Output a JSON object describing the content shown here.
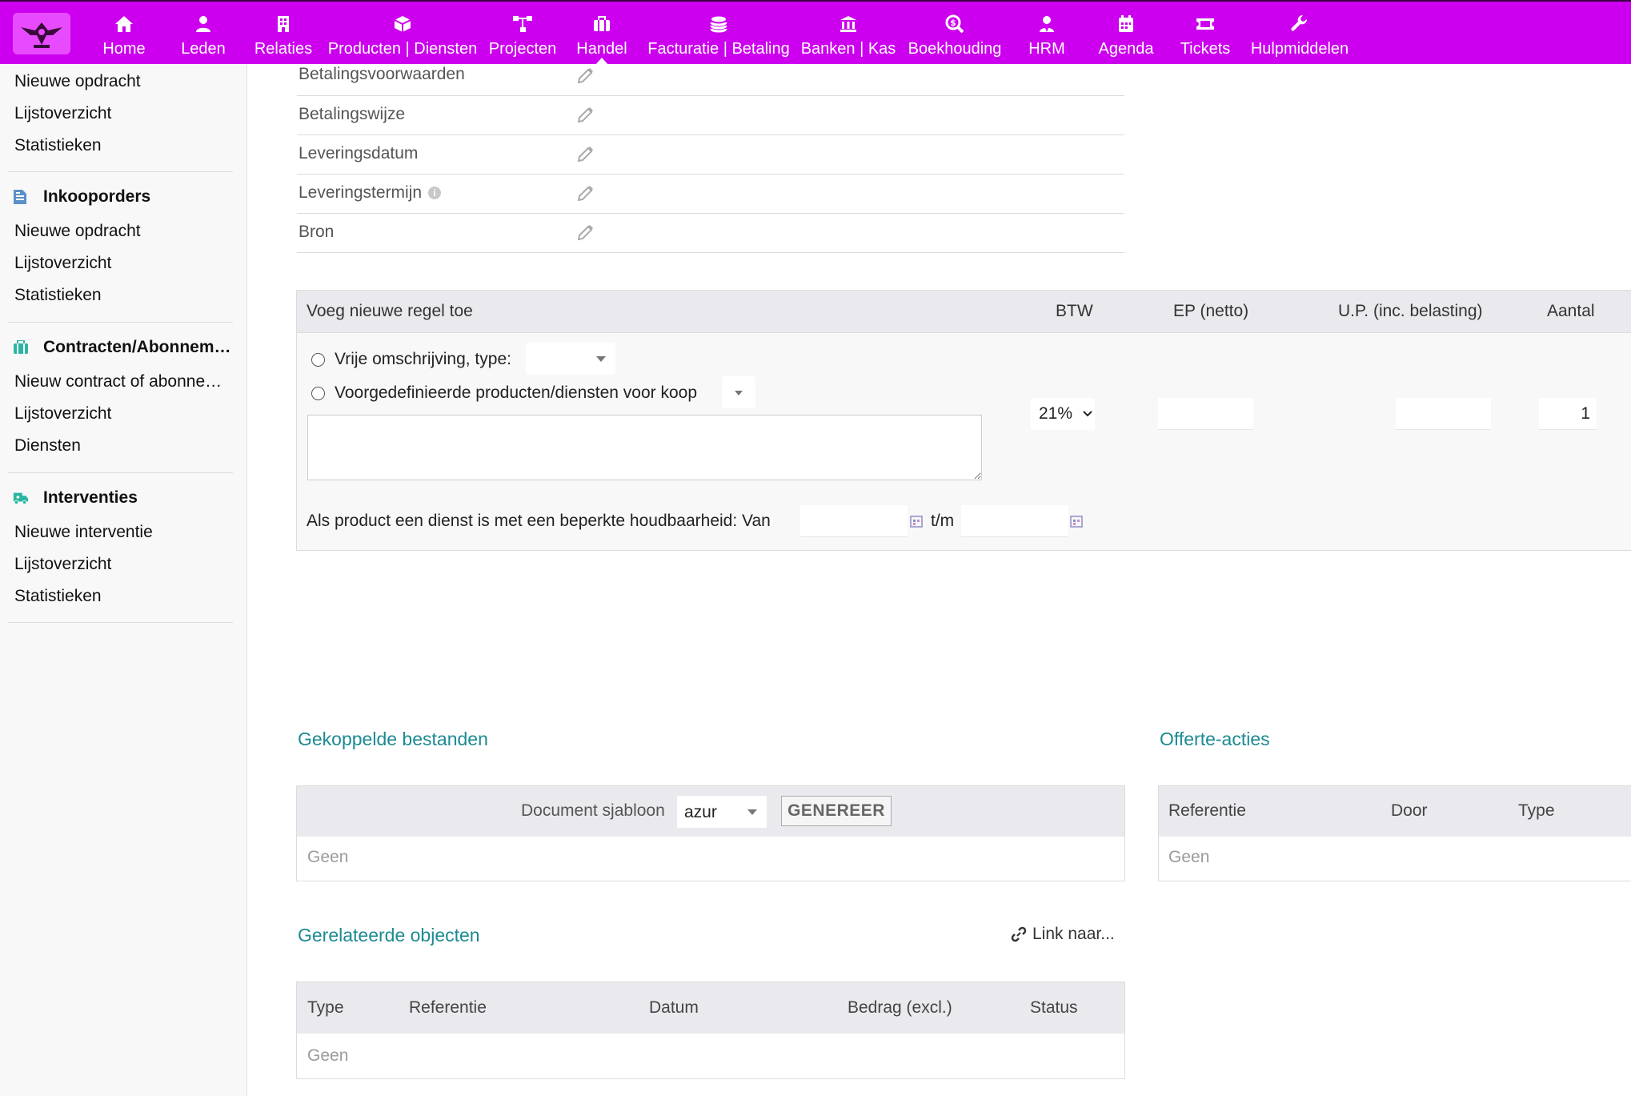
{
  "nav": {
    "items": [
      {
        "label": "Home",
        "icon": "home-icon"
      },
      {
        "label": "Leden",
        "icon": "user-icon"
      },
      {
        "label": "Relaties",
        "icon": "building-icon"
      },
      {
        "label": "Producten | Diensten",
        "icon": "cube-icon"
      },
      {
        "label": "Projecten",
        "icon": "sitemap-icon"
      },
      {
        "label": "Handel",
        "icon": "briefcase-icon"
      },
      {
        "label": "Facturatie | Betaling",
        "icon": "coins-icon"
      },
      {
        "label": "Banken | Kas",
        "icon": "bank-icon"
      },
      {
        "label": "Boekhouding",
        "icon": "search-dollar-icon"
      },
      {
        "label": "HRM",
        "icon": "user-tie-icon"
      },
      {
        "label": "Agenda",
        "icon": "calendar-icon"
      },
      {
        "label": "Tickets",
        "icon": "ticket-icon"
      },
      {
        "label": "Hulpmiddelen",
        "icon": "wrench-icon"
      }
    ],
    "active": "Handel",
    "background": "#cc00ee"
  },
  "sidebar": {
    "top_links": [
      "Nieuwe opdracht",
      "Lijstoverzicht",
      "Statistieken"
    ],
    "sections": [
      {
        "title": "Inkooporders",
        "icon": "document-icon",
        "color": "#5b8fc7",
        "links": [
          "Nieuwe opdracht",
          "Lijstoverzicht",
          "Statistieken"
        ]
      },
      {
        "title": "Contracten/Abonnementen",
        "icon": "suitcase-icon",
        "color": "#2bb5a2",
        "links": [
          "Nieuw contract of abonnement",
          "Lijstoverzicht",
          "Diensten"
        ]
      },
      {
        "title": "Interventies",
        "icon": "ambulance-icon",
        "color": "#2bb5a2",
        "links": [
          "Nieuwe interventie",
          "Lijstoverzicht",
          "Statistieken"
        ]
      }
    ]
  },
  "fields": [
    {
      "label": "Betalingsvoorwaarden",
      "info": false
    },
    {
      "label": "Betalingswijze",
      "info": false
    },
    {
      "label": "Leveringsdatum",
      "info": false
    },
    {
      "label": "Leveringstermijn",
      "info": true
    },
    {
      "label": "Bron",
      "info": false
    }
  ],
  "addline": {
    "title": "Voeg nieuwe regel toe",
    "col_vat": "BTW",
    "col_ep": "EP (netto)",
    "col_up": "U.P. (inc. belasting)",
    "col_qty": "Aantal",
    "option_free": "Vrije omschrijving, type:",
    "option_predef": "Voorgedefinieerde producten/diensten voor koop",
    "vat_value": "21%",
    "qty_value": "1",
    "period_label": "Als product een dienst is met een beperkte houdbaarheid: Van",
    "period_to": "t/m"
  },
  "files": {
    "title": "Gekoppelde bestanden",
    "template_label": "Document sjabloon",
    "template_value": "azur",
    "generate_label": "GENEREER",
    "empty": "Geen"
  },
  "actions": {
    "title": "Offerte-acties",
    "cols": [
      "Referentie",
      "Door",
      "Type"
    ],
    "empty": "Geen"
  },
  "related": {
    "title": "Gerelateerde objecten",
    "link_label": "Link naar...",
    "cols": [
      "Type",
      "Referentie",
      "Datum",
      "Bedrag (excl.)",
      "Status"
    ],
    "empty": "Geen"
  }
}
